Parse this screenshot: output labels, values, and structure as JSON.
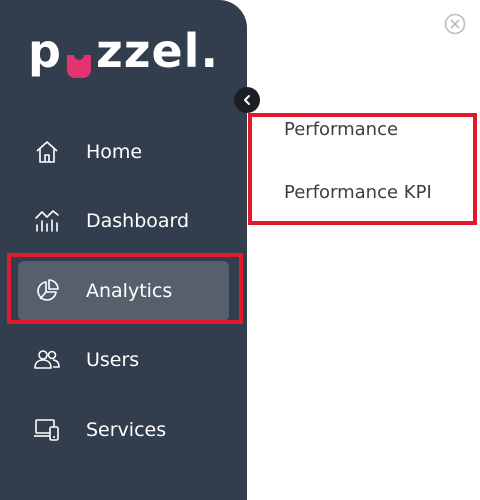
{
  "brand": {
    "logo_text_start": "p",
    "logo_text_end": "zzel",
    "logo_dot": ".",
    "accent_color": "#e4346f"
  },
  "sidebar": {
    "items": [
      {
        "label": "Home",
        "icon": "home-icon"
      },
      {
        "label": "Dashboard",
        "icon": "dashboard-icon"
      },
      {
        "label": "Analytics",
        "icon": "analytics-pie-icon",
        "active": true
      },
      {
        "label": "Users",
        "icon": "users-icon"
      },
      {
        "label": "Services",
        "icon": "services-devices-icon"
      }
    ]
  },
  "submenu": {
    "items": [
      {
        "label": "Performance"
      },
      {
        "label": "Performance KPI"
      }
    ]
  },
  "colors": {
    "sidebar_bg": "#323e4d",
    "active_item_bg": "#565f6b",
    "highlight_border": "#e11b2b"
  }
}
